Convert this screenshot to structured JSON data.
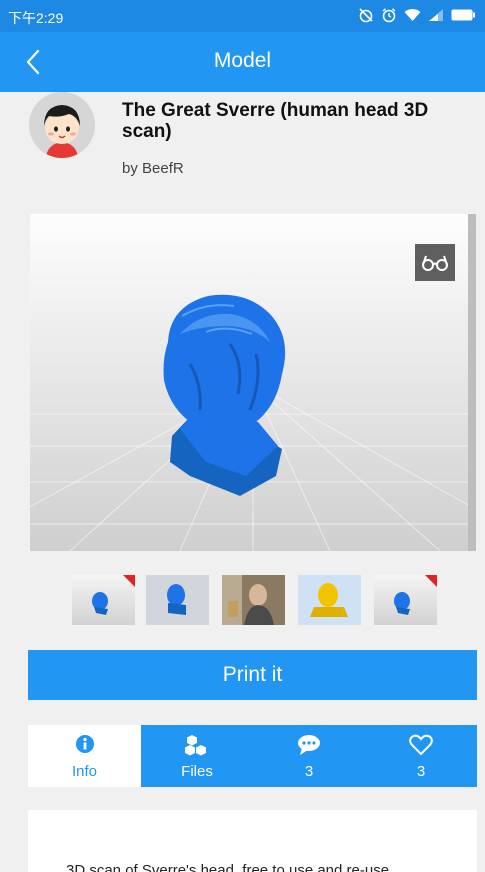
{
  "status_bar": {
    "time": "下午2:29",
    "icons": [
      "alarm-off-icon",
      "alarm-icon",
      "wifi-icon",
      "signal-icon",
      "battery-icon"
    ]
  },
  "app_bar": {
    "title": "Model",
    "back_icon": "chevron-left-icon"
  },
  "model": {
    "title": "The Great Sverre (human head 3D scan)",
    "author": "by BeefR",
    "model_color": "#1E73E8"
  },
  "viewer": {
    "vr_icon": "vr-glasses-icon"
  },
  "thumbnails": [
    {
      "kind": "blue-model",
      "marked": true
    },
    {
      "kind": "blue-model",
      "marked": false
    },
    {
      "kind": "photo",
      "marked": false
    },
    {
      "kind": "yellow-model",
      "marked": false
    },
    {
      "kind": "blue-model",
      "marked": true
    }
  ],
  "actions": {
    "print_label": "Print it"
  },
  "tabs": [
    {
      "label": "Info",
      "icon": "info-icon",
      "active": true
    },
    {
      "label": "Files",
      "icon": "files-icon",
      "active": false
    },
    {
      "label": "3",
      "icon": "comment-icon",
      "active": false
    },
    {
      "label": "3",
      "icon": "heart-icon",
      "active": false
    }
  ],
  "description": {
    "text": "3D scan of Sverre's head, free to use and re-use"
  },
  "colors": {
    "primary": "#2196F3",
    "status_bar": "#1E88E5",
    "thumb_marker": "#E0232B"
  }
}
